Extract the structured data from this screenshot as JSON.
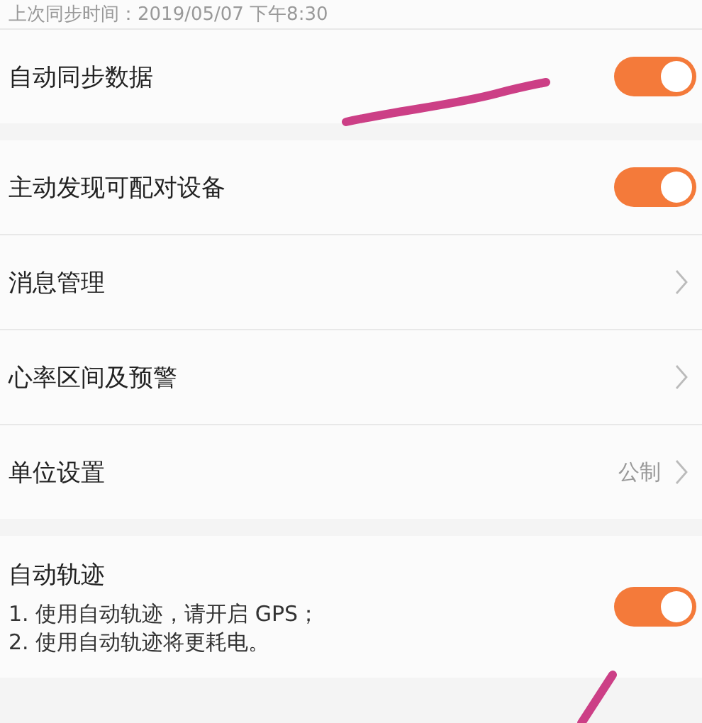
{
  "sync_time": "上次同步时间：2019/05/07 下午8:30",
  "groups": [
    {
      "rows": [
        {
          "kind": "toggle",
          "label": "自动同步数据",
          "on": true
        }
      ]
    },
    {
      "rows": [
        {
          "kind": "toggle",
          "label": "主动发现可配对设备",
          "on": true
        },
        {
          "kind": "link",
          "label": "消息管理"
        },
        {
          "kind": "link",
          "label": "心率区间及预警"
        },
        {
          "kind": "link",
          "label": "单位设置",
          "value": "公制"
        }
      ]
    },
    {
      "rows": [
        {
          "kind": "toggle",
          "label": "自动轨迹",
          "lines": [
            "1. 使用自动轨迹，请开启 GPS；",
            "2. 使用自动轨迹将更耗电。"
          ],
          "on": true
        }
      ]
    }
  ]
}
